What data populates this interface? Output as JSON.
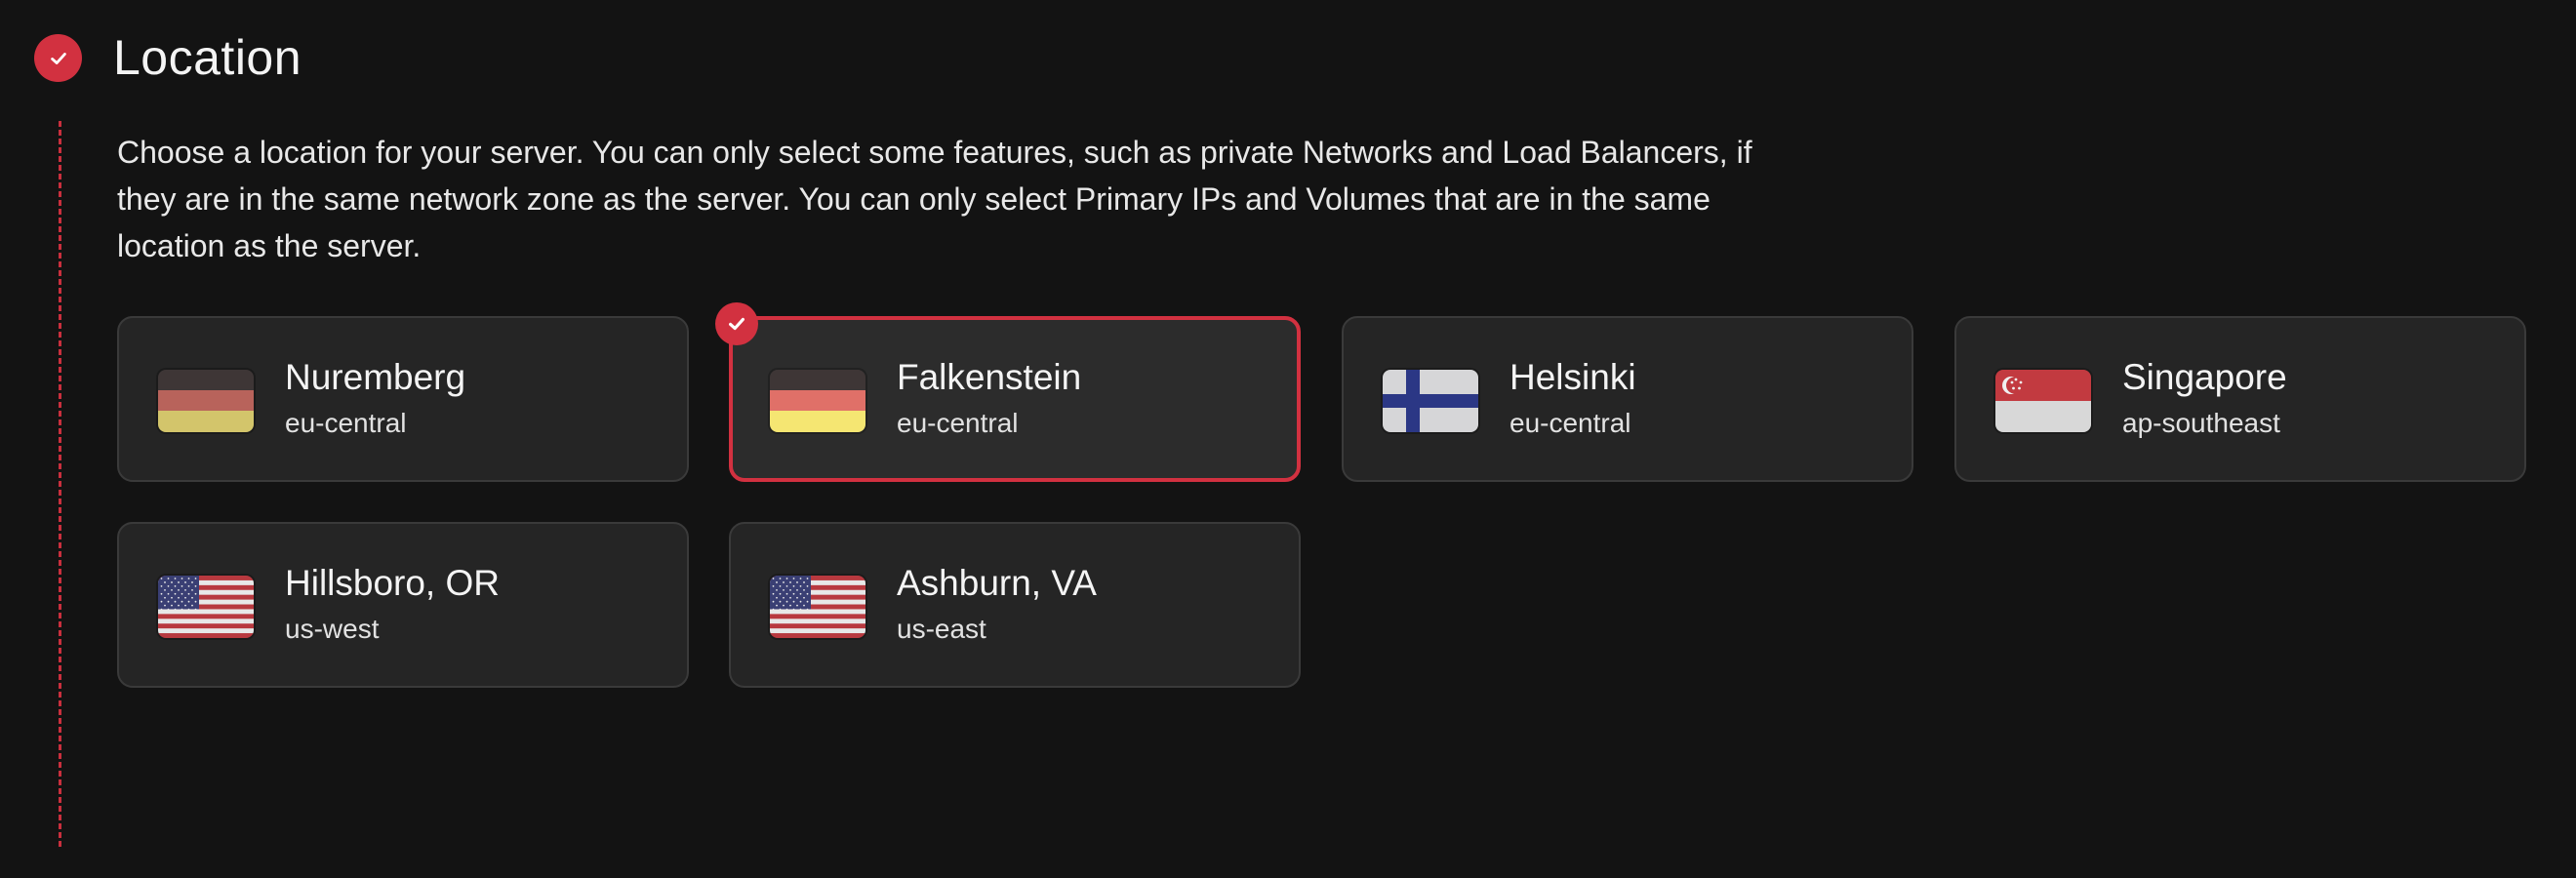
{
  "section": {
    "title": "Location",
    "description": "Choose a location for your server. You can only select some features, such as private Networks and Load Balancers, if they are in the same network zone as the server. You can only select Primary IPs and Volumes that are in the same location as the server.",
    "status_icon": "check-icon"
  },
  "colors": {
    "accent": "#d23140",
    "background": "#131313",
    "card_background": "#252525",
    "card_border": "#3a3a3a"
  },
  "locations": [
    {
      "name": "Nuremberg",
      "zone": "eu-central",
      "flag": "germany-flag-icon",
      "selected": false
    },
    {
      "name": "Falkenstein",
      "zone": "eu-central",
      "flag": "germany-flag-icon",
      "selected": true
    },
    {
      "name": "Helsinki",
      "zone": "eu-central",
      "flag": "finland-flag-icon",
      "selected": false
    },
    {
      "name": "Singapore",
      "zone": "ap-southeast",
      "flag": "singapore-flag-icon",
      "selected": false
    },
    {
      "name": "Hillsboro, OR",
      "zone": "us-west",
      "flag": "usa-flag-icon",
      "selected": false
    },
    {
      "name": "Ashburn, VA",
      "zone": "us-east",
      "flag": "usa-flag-icon",
      "selected": false
    }
  ]
}
